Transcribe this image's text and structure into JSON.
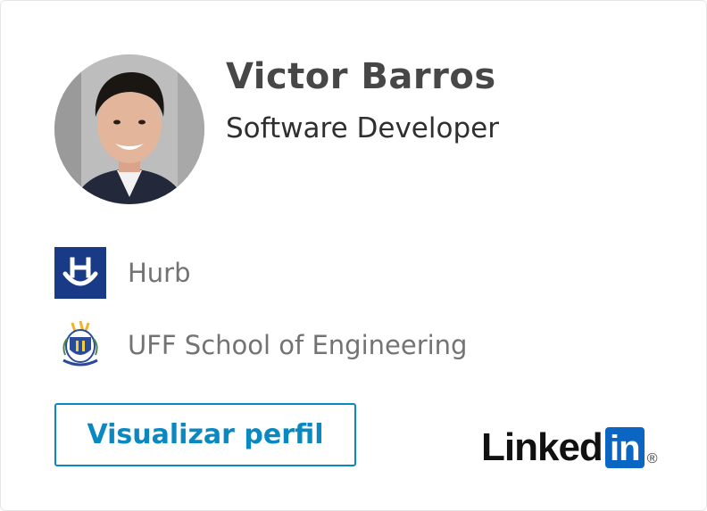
{
  "profile": {
    "name": "Victor Barros",
    "headline": "Software Developer",
    "avatar_icon": "profile-photo"
  },
  "experience": {
    "company": "Hurb",
    "company_logo_icon": "hurb-logo-icon",
    "company_logo_color": "#193a86"
  },
  "education": {
    "school": "UFF School of Engineering",
    "school_logo_icon": "uff-crest-icon"
  },
  "actions": {
    "view_profile_label": "Visualizar perfil"
  },
  "brand": {
    "name": "Linked",
    "badge": "in",
    "registered_mark": "®",
    "accent_color": "#0a66c2"
  },
  "colors": {
    "button_accent": "#0a88c2",
    "name_text": "#474747",
    "secondary_text": "#737373"
  }
}
